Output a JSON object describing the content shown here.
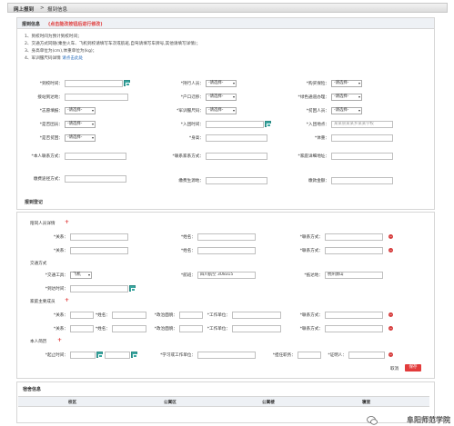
{
  "breadcrumb": {
    "root": "网上报到",
    "sep": ">",
    "current": "报到信息"
  },
  "info_panel": {
    "title": "报到信息",
    "title_note": "(点击能改按钮后进行修改)",
    "notes": [
      "1、到校时间为预计到校时间；",
      "2、交通方式同随(乘坐火车、飞机到校请填写车次或航班,自驾请填写车牌号,其他请填写详情)；",
      "3、身高单位为(cm),体重单位为(kg)；",
      "4、军训服尺码详情"
    ],
    "notes_link": "请点击此处"
  },
  "form": {
    "arrival_time": "*到校时间：",
    "has_companion": "*持行人员：",
    "need_insurance": "*购买保险：",
    "arrive_place": "接站到达地：",
    "hukou_move": "*户口迁移：",
    "green_channel": "*绿色通道办理：",
    "dorm_apply": "*志愿填报：",
    "military_size": "*军训服尺码：",
    "poor_student": "*贫困人员：",
    "is_party": "*是否团员：",
    "party_time": "*入团时间：",
    "party_place": "*入团地点：",
    "party_place_placeholder": "某某县某某乡某某学校",
    "is_poor": "*是否贫困：",
    "height": "*身高：",
    "weight": "*体重：",
    "student_contact": "*本人联系方式：",
    "family_contact": "*联系家系方式：",
    "family_address": "*家庭详细地址：",
    "fee_method": "缴费途径方式：",
    "fee_place": "缴费生源地：",
    "fee_amount": "缴款金额：",
    "select_default": "-请选择-"
  },
  "panel2": {
    "title": "报到登记",
    "companion_title": "陪同人员详情",
    "relation": "*关系：",
    "name": "*姓名：",
    "contact": "*联系方式：",
    "transport_title": "交通方式",
    "transport_tool": "*交通工具：",
    "transport_value": "飞机",
    "flight": "*航班：",
    "flight_value": "四川航空 3U8315",
    "arrive_at": "*抵达地：",
    "arrive_value": "杭州萧山",
    "depart_time": "*到达时间：",
    "family_title": "家庭主要成员",
    "member_relation": "*关系：",
    "member_name": "*姓名：",
    "politics": "*政治面貌：",
    "work_unit": "*工作单位：",
    "member_contact": "*联系方式：",
    "resume_title": "本人简历",
    "start_end": "*起止时间：",
    "study_unit": "*学习或工作单位：",
    "position": "*担任职务：",
    "witness": "*证明人：",
    "cancel": "取消",
    "save": "保存"
  },
  "panel3": {
    "title": "宿舍信息",
    "columns": [
      "校区",
      "公寓区",
      "公寓楼",
      "寝室"
    ]
  },
  "watermark": "阜阳师范学院"
}
